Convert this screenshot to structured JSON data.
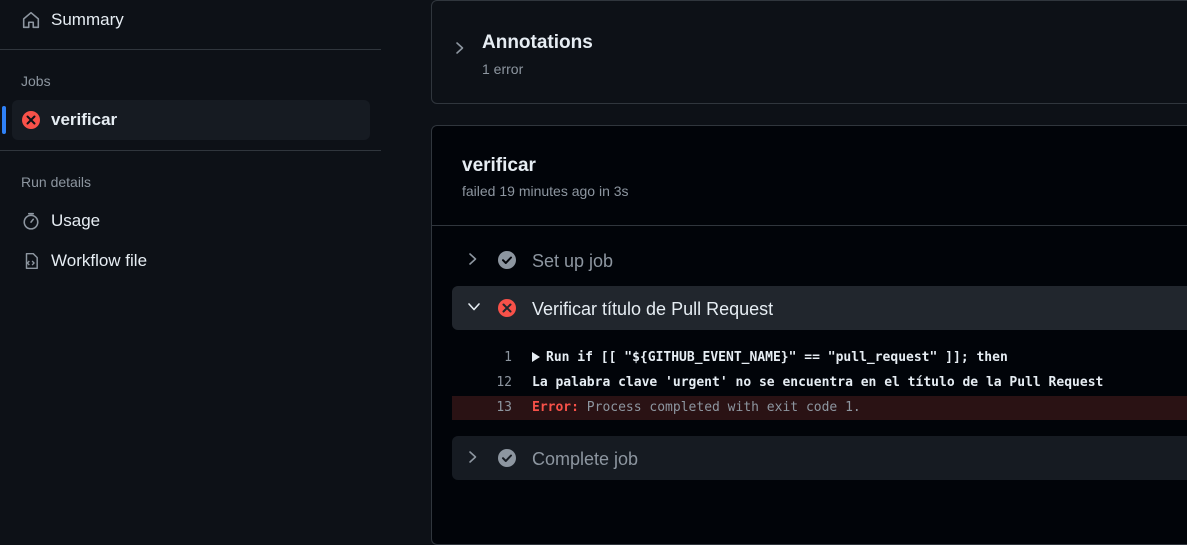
{
  "sidebar": {
    "summary_label": "Summary",
    "jobs_heading": "Jobs",
    "job_label": "verificar",
    "run_details_heading": "Run details",
    "usage_label": "Usage",
    "workflow_label": "Workflow file"
  },
  "annotations": {
    "title": "Annotations",
    "subtitle": "1 error"
  },
  "job": {
    "title": "verificar",
    "subtitle": "failed 19 minutes ago in 3s",
    "steps": [
      {
        "label": "Set up job",
        "status": "success"
      },
      {
        "label": "Verificar título de Pull Request",
        "status": "failed"
      },
      {
        "label": "Complete job",
        "status": "success"
      }
    ],
    "log": [
      {
        "num": "1",
        "text": "Run if [[ \"${GITHUB_EVENT_NAME}\" == \"pull_request\" ]]; then"
      },
      {
        "num": "12",
        "text": "La palabra clave 'urgent' no se encuentra en el título de la Pull Request"
      },
      {
        "num": "13",
        "error_label": "Error:",
        "text": " Process completed with exit code 1."
      }
    ]
  },
  "colors": {
    "background": "#0d1117",
    "accent": "#2f81f7",
    "error": "#f85149",
    "success_icon": "#8d96a0"
  },
  "icons": [
    "home-icon",
    "x-circle-icon",
    "stopwatch-icon",
    "file-code-icon",
    "chevron-right-icon",
    "chevron-down-icon",
    "check-circle-icon"
  ]
}
